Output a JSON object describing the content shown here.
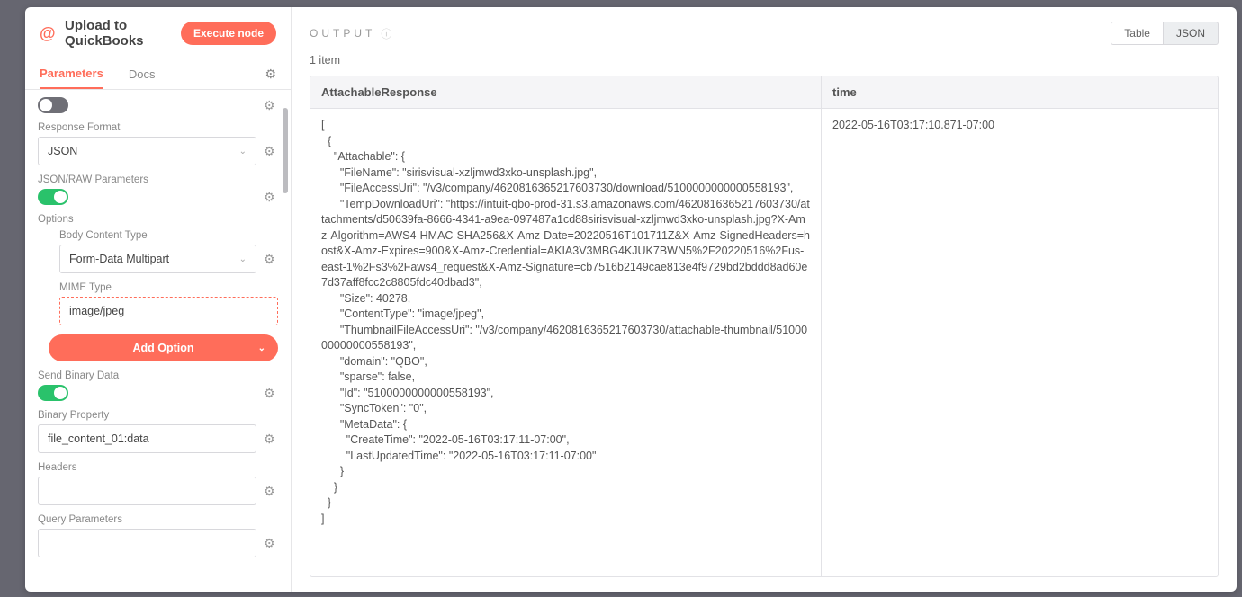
{
  "header": {
    "title": "Upload to QuickBooks",
    "execute_label": "Execute node"
  },
  "tabs": {
    "parameters": "Parameters",
    "docs": "Docs"
  },
  "params": {
    "response_format_label": "Response Format",
    "response_format_value": "JSON",
    "json_raw_label": "JSON/RAW Parameters",
    "options_label": "Options",
    "body_content_type_label": "Body Content Type",
    "body_content_type_value": "Form-Data Multipart",
    "mime_label": "MIME Type",
    "mime_value": "image/jpeg",
    "add_option_label": "Add Option",
    "send_binary_label": "Send Binary Data",
    "binary_prop_label": "Binary Property",
    "binary_prop_value": "file_content_01:data",
    "headers_label": "Headers",
    "headers_value": "",
    "query_label": "Query Parameters",
    "query_value": ""
  },
  "output": {
    "title": "OUTPUT",
    "view_table": "Table",
    "view_json": "JSON",
    "item_count": "1 item",
    "columns": {
      "col1": "AttachableResponse",
      "col2": "time"
    },
    "row": {
      "attachable": "[\n  {\n    \"Attachable\": {\n      \"FileName\": \"sirisvisual-xzljmwd3xko-unsplash.jpg\",\n      \"FileAccessUri\": \"/v3/company/4620816365217603730/download/5100000000000558193\",\n      \"TempDownloadUri\": \"https://intuit-qbo-prod-31.s3.amazonaws.com/4620816365217603730/attachments/d50639fa-8666-4341-a9ea-097487a1cd88sirisvisual-xzljmwd3xko-unsplash.jpg?X-Amz-Algorithm=AWS4-HMAC-SHA256&X-Amz-Date=20220516T101711Z&X-Amz-SignedHeaders=host&X-Amz-Expires=900&X-Amz-Credential=AKIA3V3MBG4KJUK7BWN5%2F20220516%2Fus-east-1%2Fs3%2Faws4_request&X-Amz-Signature=cb7516b2149cae813e4f9729bd2bddd8ad60e7d37aff8fcc2c8805fdc40dbad3\",\n      \"Size\": 40278,\n      \"ContentType\": \"image/jpeg\",\n      \"ThumbnailFileAccessUri\": \"/v3/company/4620816365217603730/attachable-thumbnail/5100000000000558193\",\n      \"domain\": \"QBO\",\n      \"sparse\": false,\n      \"Id\": \"5100000000000558193\",\n      \"SyncToken\": \"0\",\n      \"MetaData\": {\n        \"CreateTime\": \"2022-05-16T03:17:11-07:00\",\n        \"LastUpdatedTime\": \"2022-05-16T03:17:11-07:00\"\n      }\n    }\n  }\n]",
      "time": "2022-05-16T03:17:10.871-07:00"
    }
  }
}
